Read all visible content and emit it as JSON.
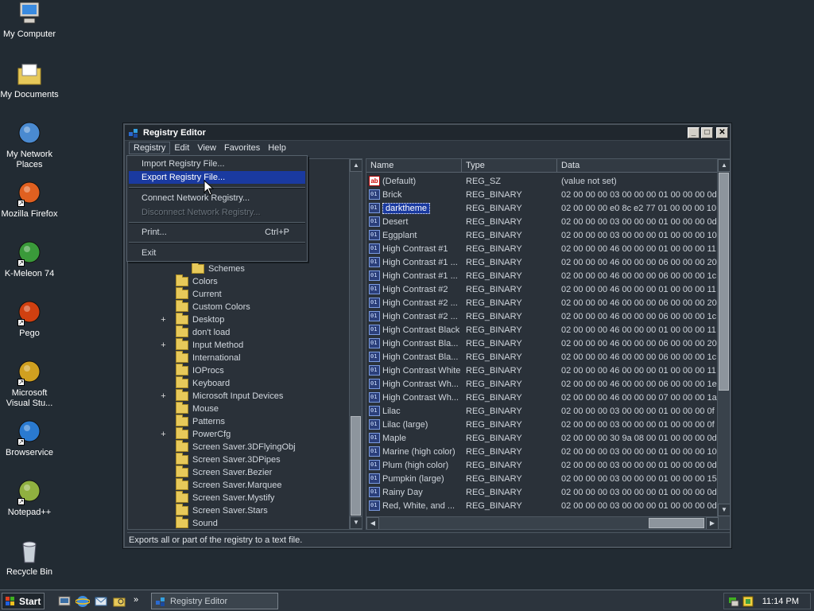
{
  "desktop": {
    "icons": [
      {
        "label": "My Computer",
        "icon": "computer-icon"
      },
      {
        "label": "My Documents",
        "icon": "documents-folder-icon"
      },
      {
        "label": "My Network Places",
        "icon": "network-icon"
      },
      {
        "label": "Mozilla Firefox",
        "icon": "firefox-icon"
      },
      {
        "label": "K-Meleon 74",
        "icon": "kmeleon-icon"
      },
      {
        "label": "Pego",
        "icon": "pego-icon"
      },
      {
        "label": "Microsoft Visual Stu...",
        "icon": "visual-studio-icon"
      },
      {
        "label": "Browservice",
        "icon": "ie-icon"
      },
      {
        "label": "Notepad++",
        "icon": "notepadpp-icon"
      },
      {
        "label": "Recycle Bin",
        "icon": "recycle-bin-icon"
      }
    ]
  },
  "window": {
    "title": "Registry Editor",
    "menu": [
      "Registry",
      "Edit",
      "View",
      "Favorites",
      "Help"
    ],
    "status": "Exports all or part of the registry to a text file."
  },
  "dropdown": {
    "items": [
      {
        "label": "Import Registry File...",
        "shortcut": "",
        "state": "normal"
      },
      {
        "label": "Export Registry File...",
        "shortcut": "",
        "state": "highlighted"
      },
      {
        "label": "Connect Network Registry...",
        "shortcut": "",
        "state": "normal"
      },
      {
        "label": "Disconnect Network Registry...",
        "shortcut": "",
        "state": "disabled"
      },
      {
        "label": "Print...",
        "shortcut": "Ctrl+P",
        "state": "normal"
      },
      {
        "label": "Exit",
        "shortcut": "",
        "state": "normal"
      }
    ]
  },
  "tree": {
    "items": [
      {
        "label": "Schemes",
        "expander": ""
      },
      {
        "label": "Colors",
        "expander": ""
      },
      {
        "label": "Current",
        "expander": ""
      },
      {
        "label": "Custom Colors",
        "expander": ""
      },
      {
        "label": "Desktop",
        "expander": "+"
      },
      {
        "label": "don't load",
        "expander": ""
      },
      {
        "label": "Input Method",
        "expander": "+"
      },
      {
        "label": "International",
        "expander": ""
      },
      {
        "label": "IOProcs",
        "expander": ""
      },
      {
        "label": "Keyboard",
        "expander": ""
      },
      {
        "label": "Microsoft Input Devices",
        "expander": "+"
      },
      {
        "label": "Mouse",
        "expander": ""
      },
      {
        "label": "Patterns",
        "expander": ""
      },
      {
        "label": "PowerCfg",
        "expander": "+"
      },
      {
        "label": "Screen Saver.3DFlyingObj",
        "expander": ""
      },
      {
        "label": "Screen Saver.3DPipes",
        "expander": ""
      },
      {
        "label": "Screen Saver.Bezier",
        "expander": ""
      },
      {
        "label": "Screen Saver.Marquee",
        "expander": ""
      },
      {
        "label": "Screen Saver.Mystify",
        "expander": ""
      },
      {
        "label": "Screen Saver.Stars",
        "expander": ""
      },
      {
        "label": "Sound",
        "expander": ""
      }
    ]
  },
  "list": {
    "columns": [
      "Name",
      "Type",
      "Data"
    ],
    "rows": [
      {
        "name": "(Default)",
        "type": "REG_SZ",
        "data": "(value not set)",
        "kind": "sz"
      },
      {
        "name": "Brick",
        "type": "REG_BINARY",
        "data": "02 00 00 00 03 00 00 00 01 00 00 00 0d",
        "kind": "bin"
      },
      {
        "name": "darktheme",
        "type": "REG_BINARY",
        "data": "02 00 00 00 e0 8c e2 77 01 00 00 00 10",
        "kind": "bin",
        "selected": true
      },
      {
        "name": "Desert",
        "type": "REG_BINARY",
        "data": "02 00 00 00 03 00 00 00 01 00 00 00 0d",
        "kind": "bin"
      },
      {
        "name": "Eggplant",
        "type": "REG_BINARY",
        "data": "02 00 00 00 03 00 00 00 01 00 00 00 10",
        "kind": "bin"
      },
      {
        "name": "High Contrast #1",
        "type": "REG_BINARY",
        "data": "02 00 00 00 46 00 00 00 01 00 00 00 11",
        "kind": "bin"
      },
      {
        "name": "High Contrast #1 ...",
        "type": "REG_BINARY",
        "data": "02 00 00 00 46 00 00 00 06 00 00 00 20",
        "kind": "bin"
      },
      {
        "name": "High Contrast #1 ...",
        "type": "REG_BINARY",
        "data": "02 00 00 00 46 00 00 00 06 00 00 00 1c",
        "kind": "bin"
      },
      {
        "name": "High Contrast #2",
        "type": "REG_BINARY",
        "data": "02 00 00 00 46 00 00 00 01 00 00 00 11",
        "kind": "bin"
      },
      {
        "name": "High Contrast #2 ...",
        "type": "REG_BINARY",
        "data": "02 00 00 00 46 00 00 00 06 00 00 00 20",
        "kind": "bin"
      },
      {
        "name": "High Contrast #2 ...",
        "type": "REG_BINARY",
        "data": "02 00 00 00 46 00 00 00 06 00 00 00 1c",
        "kind": "bin"
      },
      {
        "name": "High Contrast Black",
        "type": "REG_BINARY",
        "data": "02 00 00 00 46 00 00 00 01 00 00 00 11",
        "kind": "bin"
      },
      {
        "name": "High Contrast Bla...",
        "type": "REG_BINARY",
        "data": "02 00 00 00 46 00 00 00 06 00 00 00 20",
        "kind": "bin"
      },
      {
        "name": "High Contrast Bla...",
        "type": "REG_BINARY",
        "data": "02 00 00 00 46 00 00 00 06 00 00 00 1c",
        "kind": "bin"
      },
      {
        "name": "High Contrast White",
        "type": "REG_BINARY",
        "data": "02 00 00 00 46 00 00 00 01 00 00 00 11",
        "kind": "bin"
      },
      {
        "name": "High Contrast Wh...",
        "type": "REG_BINARY",
        "data": "02 00 00 00 46 00 00 00 06 00 00 00 1e",
        "kind": "bin"
      },
      {
        "name": "High Contrast Wh...",
        "type": "REG_BINARY",
        "data": "02 00 00 00 46 00 00 00 07 00 00 00 1a",
        "kind": "bin"
      },
      {
        "name": "Lilac",
        "type": "REG_BINARY",
        "data": "02 00 00 00 03 00 00 00 01 00 00 00 0f",
        "kind": "bin"
      },
      {
        "name": "Lilac (large)",
        "type": "REG_BINARY",
        "data": "02 00 00 00 03 00 00 00 01 00 00 00 0f",
        "kind": "bin"
      },
      {
        "name": "Maple",
        "type": "REG_BINARY",
        "data": "02 00 00 00 30 9a 08 00 01 00 00 00 0d",
        "kind": "bin"
      },
      {
        "name": "Marine (high color)",
        "type": "REG_BINARY",
        "data": "02 00 00 00 03 00 00 00 01 00 00 00 10",
        "kind": "bin"
      },
      {
        "name": "Plum (high color)",
        "type": "REG_BINARY",
        "data": "02 00 00 00 03 00 00 00 01 00 00 00 0d",
        "kind": "bin"
      },
      {
        "name": "Pumpkin (large)",
        "type": "REG_BINARY",
        "data": "02 00 00 00 03 00 00 00 01 00 00 00 15",
        "kind": "bin"
      },
      {
        "name": "Rainy Day",
        "type": "REG_BINARY",
        "data": "02 00 00 00 03 00 00 00 01 00 00 00 0d",
        "kind": "bin"
      },
      {
        "name": "Red, White, and ...",
        "type": "REG_BINARY",
        "data": "02 00 00 00 03 00 00 00 01 00 00 00 0d",
        "kind": "bin"
      }
    ]
  },
  "taskbar": {
    "start_label": "Start",
    "task_label": "Registry Editor",
    "clock": "11:14 PM"
  },
  "colors": {
    "desktop": "#222b33",
    "selection": "#1a3aa0"
  }
}
